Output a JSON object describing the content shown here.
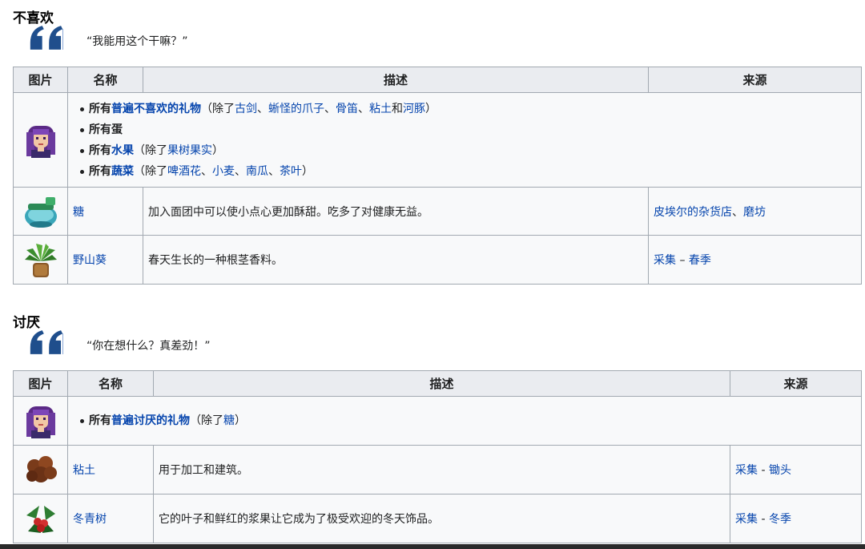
{
  "dislike": {
    "heading": "不喜欢",
    "quote": "“我能用这个干嘛？”",
    "headers": {
      "pic": "图片",
      "name": "名称",
      "desc": "描述",
      "source": "来源"
    },
    "universal": [
      {
        "prefix": "所有",
        "link": "普遍不喜欢的礼物",
        "except_open": "（除了",
        "exceptions": [
          "古剑",
          "蜥怪的爪子",
          "骨笛",
          "粘土"
        ],
        "seps": [
          "、",
          "、",
          "、",
          "和"
        ],
        "last": "河豚",
        "close": "）"
      },
      {
        "prefix": "所有蛋"
      },
      {
        "prefix": "所有",
        "link": "水果",
        "except_open": "（除了",
        "last": "果树果实",
        "close": "）"
      },
      {
        "prefix": "所有",
        "link": "蔬菜",
        "except_open": "（除了",
        "exceptions": [
          "啤酒花",
          "小麦",
          "南瓜"
        ],
        "seps": [
          "、",
          "、",
          "、"
        ],
        "last": "茶叶",
        "close": "）"
      }
    ],
    "rows": [
      {
        "name": "糖",
        "desc": "加入面团中可以使小点心更加酥甜。吃多了对健康无益。",
        "source_a": "皮埃尔的杂货店",
        "source_sep": "、",
        "source_b": "磨坊"
      },
      {
        "name": "野山葵",
        "desc": "春天生长的一种根茎香料。",
        "source_a": "采集",
        "source_sep": " – ",
        "source_b": "春季"
      }
    ]
  },
  "hate": {
    "heading": "讨厌",
    "quote": "“你在想什么？真差劲！”",
    "headers": {
      "pic": "图片",
      "name": "名称",
      "desc": "描述",
      "source": "来源"
    },
    "universal": {
      "prefix": "所有",
      "link": "普遍讨厌的礼物",
      "except_open": "（除了",
      "last": "糖",
      "close": "）"
    },
    "rows": [
      {
        "name": "粘土",
        "desc": "用于加工和建筑。",
        "source_a": "采集",
        "source_sep": " - ",
        "source_b": "锄头"
      },
      {
        "name": "冬青树",
        "desc": "它的叶子和鲜红的浆果让它成为了极受欢迎的冬天饰品。",
        "source_a": "采集",
        "source_sep": " - ",
        "source_b": "冬季"
      }
    ]
  },
  "icons": [
    "quote-icon",
    "villager-portrait-icon",
    "sugar-icon",
    "wild-horseradish-icon",
    "clay-icon",
    "holly-icon"
  ],
  "colors": {
    "link": "#0645ad",
    "header_bg": "#eaecf0",
    "cell_bg": "#f8f9fa",
    "border": "#a2a9b1",
    "quote": "#1f4e8c"
  }
}
